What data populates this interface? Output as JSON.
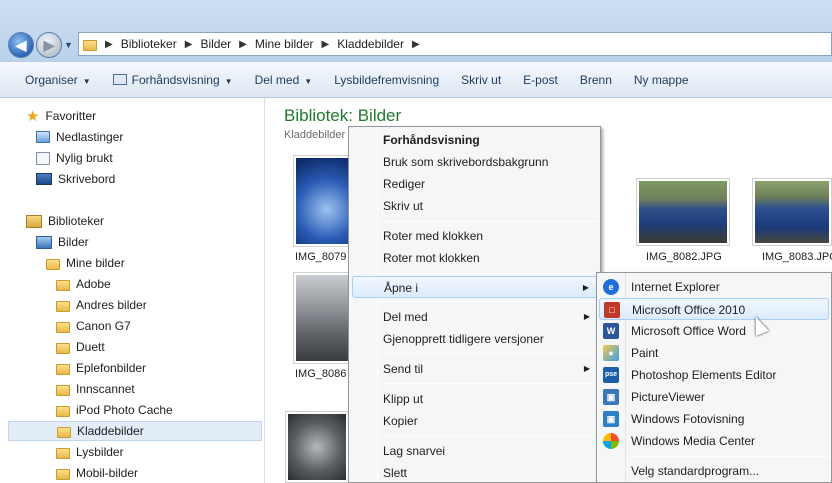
{
  "address": {
    "crumbs": [
      "Biblioteker",
      "Bilder",
      "Mine bilder",
      "Kladdebilder"
    ]
  },
  "toolbar": {
    "organise": "Organiser",
    "preview": "Forhåndsvisning",
    "share": "Del med",
    "slideshow": "Lysbildefremvisning",
    "print": "Skriv ut",
    "email": "E-post",
    "burn": "Brenn",
    "newfolder": "Ny mappe"
  },
  "nav": {
    "favorites": "Favoritter",
    "downloads": "Nedlastinger",
    "recent": "Nylig brukt",
    "desktop": "Skrivebord",
    "libraries": "Biblioteker",
    "pictures": "Bilder",
    "mypics": "Mine bilder",
    "folders": [
      "Adobe",
      "Andres bilder",
      "Canon G7",
      "Duett",
      "Eplefonbilder",
      "Innscannet",
      "iPod Photo Cache",
      "Kladdebilder",
      "Lysbilder",
      "Mobil-bilder"
    ]
  },
  "main": {
    "title": "Bibliotek: Bilder",
    "subtitle": "Kladdebilder",
    "files": [
      "IMG_8079",
      "IMG_8082.JPG",
      "IMG_8083.JPG",
      "IMG_8086"
    ]
  },
  "context_menu": {
    "items": [
      "Forhåndsvisning",
      "Bruk som skrivebordsbakgrunn",
      "Rediger",
      "Skriv ut",
      "Roter med klokken",
      "Roter mot klokken",
      "Åpne i",
      "Del med",
      "Gjenopprett tidligere versjoner",
      "Send til",
      "Klipp ut",
      "Kopier",
      "Lag snarvei",
      "Slett"
    ]
  },
  "open_with": {
    "items": [
      "Internet Explorer",
      "Microsoft Office 2010",
      "Microsoft Office Word",
      "Paint",
      "Photoshop Elements Editor",
      "PictureViewer",
      "Windows Fotovisning",
      "Windows Media Center",
      "Velg standardprogram..."
    ]
  },
  "colors": {
    "title_green": "#1d7a2b",
    "highlight": "#dcebfc",
    "highlight_border": "#a8d0f6"
  }
}
